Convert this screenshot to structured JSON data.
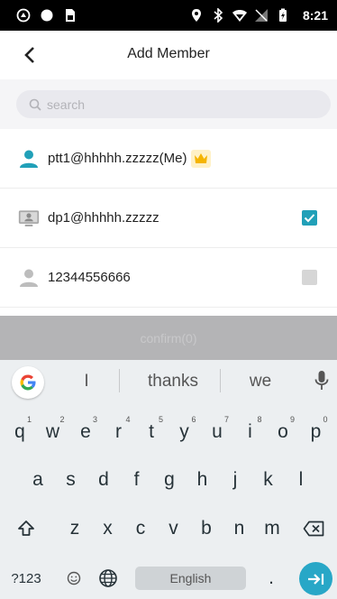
{
  "status_bar": {
    "time": "8:21"
  },
  "header": {
    "title": "Add Member"
  },
  "search": {
    "placeholder": "search",
    "value": ""
  },
  "members": [
    {
      "name": "ptt1@hhhhh.zzzzz(Me)",
      "is_me": true,
      "checked": null
    },
    {
      "name": "dp1@hhhhh.zzzzz",
      "is_me": false,
      "checked": true
    },
    {
      "name": "12344556666",
      "is_me": false,
      "checked": false
    }
  ],
  "confirm": {
    "label": "confirm(0)"
  },
  "keyboard": {
    "suggestions": [
      "I",
      "thanks",
      "we"
    ],
    "row1": [
      {
        "key": "q",
        "hint": "1"
      },
      {
        "key": "w",
        "hint": "2"
      },
      {
        "key": "e",
        "hint": "3"
      },
      {
        "key": "r",
        "hint": "4"
      },
      {
        "key": "t",
        "hint": "5"
      },
      {
        "key": "y",
        "hint": "6"
      },
      {
        "key": "u",
        "hint": "7"
      },
      {
        "key": "i",
        "hint": "8"
      },
      {
        "key": "o",
        "hint": "9"
      },
      {
        "key": "p",
        "hint": "0"
      }
    ],
    "row2": [
      "a",
      "s",
      "d",
      "f",
      "g",
      "h",
      "j",
      "k",
      "l"
    ],
    "row3": [
      "z",
      "x",
      "c",
      "v",
      "b",
      "n",
      "m"
    ],
    "symbols_label": "?123",
    "space_label": "English",
    "period_label": "."
  },
  "colors": {
    "accent": "#21a0b8",
    "confirm_bg": "#b4b4b6",
    "keyboard_bg": "#eceff1"
  }
}
